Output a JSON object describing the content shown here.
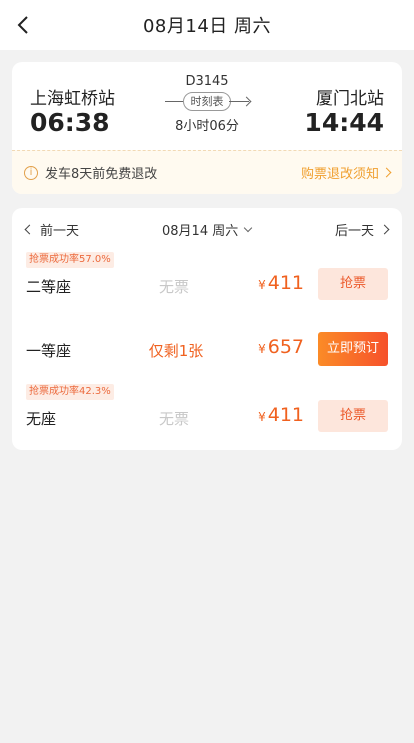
{
  "header": {
    "title": "08月14日 周六"
  },
  "train": {
    "from_station": "上海虹桥站",
    "to_station": "厦门北站",
    "departure_time": "06:38",
    "arrival_time": "14:44",
    "train_number": "D3145",
    "timetable_label": "时刻表",
    "duration": "8小时06分"
  },
  "refund": {
    "notice": "发车8天前免费退改",
    "link_label": "购票退改须知"
  },
  "day_nav": {
    "prev_label": "前一天",
    "date_label": "08月14 周六",
    "next_label": "后一天"
  },
  "seats": [
    {
      "success_rate": "抢票成功率57.0%",
      "name": "二等座",
      "availability": "无票",
      "currency": "¥",
      "price": "411",
      "action": "抢票"
    },
    {
      "name": "一等座",
      "availability": "仅剩1张",
      "currency": "¥",
      "price": "657",
      "action": "立即预订"
    },
    {
      "success_rate": "抢票成功率42.3%",
      "name": "无座",
      "availability": "无票",
      "currency": "¥",
      "price": "411",
      "action": "抢票"
    }
  ],
  "colors": {
    "accent": "#f0611f",
    "refund_link": "#f0a030",
    "unavailable": "#c8c8c8"
  }
}
